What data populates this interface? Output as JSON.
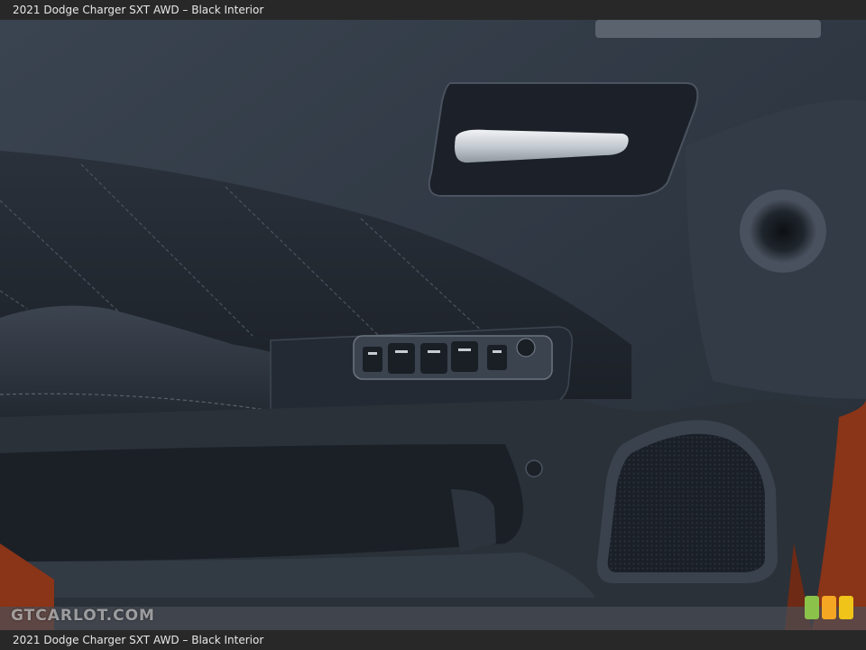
{
  "caption": {
    "top": "2021 Dodge Charger SXT AWD – Black Interior",
    "bottom": "2021 Dodge Charger SXT AWD – Black Interior"
  },
  "photo": {
    "subject": "door-panel",
    "elements": [
      "door-handle-icon",
      "window-switch-icon",
      "tweeter-icon",
      "speaker-grille-icon",
      "armrest-icon"
    ]
  },
  "watermark": {
    "text": "GTCARLOT.COM"
  },
  "colors": {
    "panel": "#2b333e",
    "leather": "#1f252d",
    "chrome": "#c9ced4",
    "exterior_paint": "#8a3418",
    "logo": [
      "#8bc34a",
      "#f5a623",
      "#f0c419"
    ]
  }
}
